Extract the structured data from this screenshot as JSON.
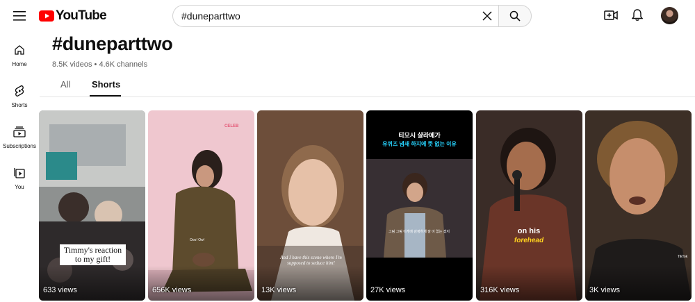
{
  "app": {
    "logo_text": "YouTube"
  },
  "search": {
    "value": "#duneparttwo",
    "placeholder": "Search"
  },
  "sidebar": {
    "items": [
      {
        "label": "Home",
        "icon": "home-icon"
      },
      {
        "label": "Shorts",
        "icon": "shorts-icon"
      },
      {
        "label": "Subscriptions",
        "icon": "subscriptions-icon"
      },
      {
        "label": "You",
        "icon": "you-icon"
      }
    ]
  },
  "header": {
    "hashtag": "#duneparttwo",
    "stats": "8.5K videos • 4.6K channels"
  },
  "tabs": [
    {
      "label": "All",
      "selected": false
    },
    {
      "label": "Shorts",
      "selected": true
    }
  ],
  "shorts": [
    {
      "views": "633 views",
      "caption": "Timmy's reaction to my gift!"
    },
    {
      "views": "656K views",
      "caption": "Ooo! Ow!",
      "badge": "CELEB"
    },
    {
      "views": "13K views",
      "caption": "And I have this scene where I'm supposed to seduce him!"
    },
    {
      "views": "27K views",
      "caption_line1": "티모시 샬라메가",
      "caption_line2": "유퀴즈 냄새 하지에 뜻 없는 이유",
      "caption_line3": "그림 그림 이게에 감정하게 잘 이 없는 겠지"
    },
    {
      "views": "316K views",
      "caption_line1": "on his",
      "caption_line2": "forehead"
    },
    {
      "views": "3K views",
      "badge": "TikTok"
    }
  ],
  "colors": {
    "brand_red": "#ff0000",
    "text": "#0f0f0f",
    "secondary_text": "#606060"
  }
}
